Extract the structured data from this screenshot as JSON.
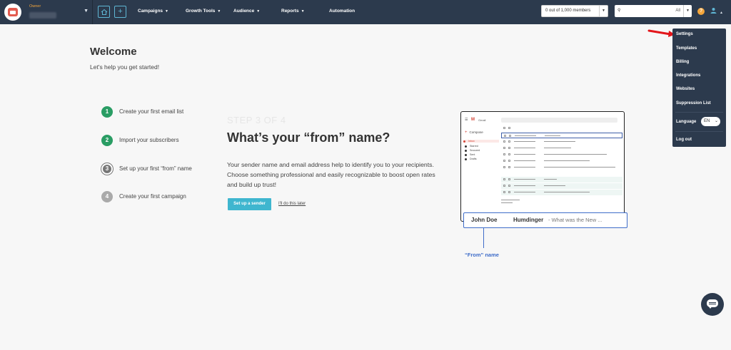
{
  "topbar": {
    "account_role": "Owner",
    "nav": [
      {
        "label": "Campaigns"
      },
      {
        "label": "Growth Tools"
      },
      {
        "label": "Audience"
      },
      {
        "label": "Reports"
      },
      {
        "label": "Automation"
      }
    ],
    "members": "0 out of 1,000 members",
    "search_scope": "All",
    "help": "?"
  },
  "menu": {
    "items": [
      "Settings",
      "Templates",
      "Billing",
      "Integrations",
      "Websites",
      "Suppression List"
    ],
    "language_label": "Language",
    "language_value": "EN",
    "logout": "Log out"
  },
  "welcome": {
    "title": "Welcome",
    "subtitle": "Let's help you get started!"
  },
  "steps": [
    {
      "num": "1",
      "label": "Create your first email list",
      "status": "done"
    },
    {
      "num": "2",
      "label": "Import your subscribers",
      "status": "done"
    },
    {
      "num": "3",
      "label": "Set up your first “from” name",
      "status": "current"
    },
    {
      "num": "4",
      "label": "Create your first campaign",
      "status": "todo"
    }
  ],
  "main": {
    "step_of": "STEP 3 OF 4",
    "heading": "What’s your “from” name?",
    "description": "Your sender name and email address help to identify you to your recipients. Choose something professional and easily recognizable to boost open rates and build up trust!",
    "primary_button": "Set up a sender",
    "later_link": "I'll do this later"
  },
  "illustration": {
    "app_name": "Gmail",
    "compose": "Compose",
    "folders": [
      "Inbox",
      "Starred",
      "Snoozed",
      "Sent",
      "Drafts"
    ],
    "from_name": "John Doe",
    "subject": "Humdinger",
    "preview": "- What was the New ...",
    "caption": "“From” name"
  },
  "colors": {
    "nav_bg": "#2c3a4d",
    "accent": "#3fb6cf",
    "done": "#2a9d64",
    "highlight": "#3f6dc9"
  }
}
